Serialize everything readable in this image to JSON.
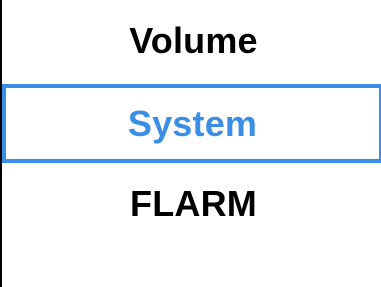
{
  "menu": {
    "items": [
      {
        "label": "Volume",
        "selected": false
      },
      {
        "label": "System",
        "selected": true
      },
      {
        "label": "FLARM",
        "selected": false
      }
    ]
  },
  "colors": {
    "selected_accent": "#3a8ee6",
    "text": "#000000",
    "background": "#ffffff",
    "frame_border": "#000000"
  }
}
